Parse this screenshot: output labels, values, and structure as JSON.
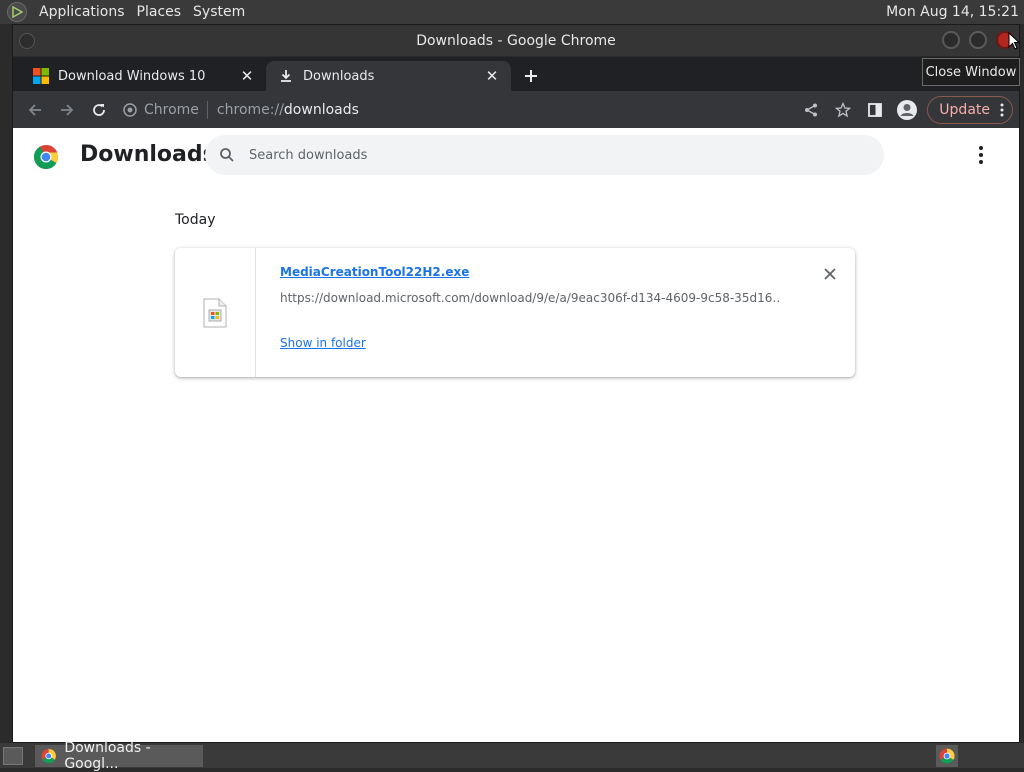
{
  "desktop": {
    "menus": [
      "Applications",
      "Places",
      "System"
    ],
    "clock": "Mon Aug 14, 15:21"
  },
  "window": {
    "title": "Downloads - Google Chrome",
    "tooltip": "Close Window"
  },
  "tabs": [
    {
      "title": "Download Windows 10",
      "favicon": "windows-logo-icon",
      "active": false
    },
    {
      "title": "Downloads",
      "favicon": "download-icon",
      "active": true
    }
  ],
  "toolbar": {
    "site_chip": "Chrome",
    "url_scheme": "chrome://",
    "url_host": "downloads",
    "update_label": "Update"
  },
  "page": {
    "title": "Downloads",
    "search_placeholder": "Search downloads",
    "section_label": "Today",
    "downloads": [
      {
        "file_name": "MediaCreationTool22H2.exe",
        "url": "https://download.microsoft.com/download/9/e/a/9eac306f-d134-4609-9c58-35d16…",
        "action": "Show in folder"
      }
    ]
  },
  "taskbar": {
    "task_title": "Downloads - Googl..."
  },
  "colors": {
    "accent": "#1a73e8",
    "update": "#f28b82",
    "tabstrip": "#202124",
    "toolbar": "#35363a"
  }
}
